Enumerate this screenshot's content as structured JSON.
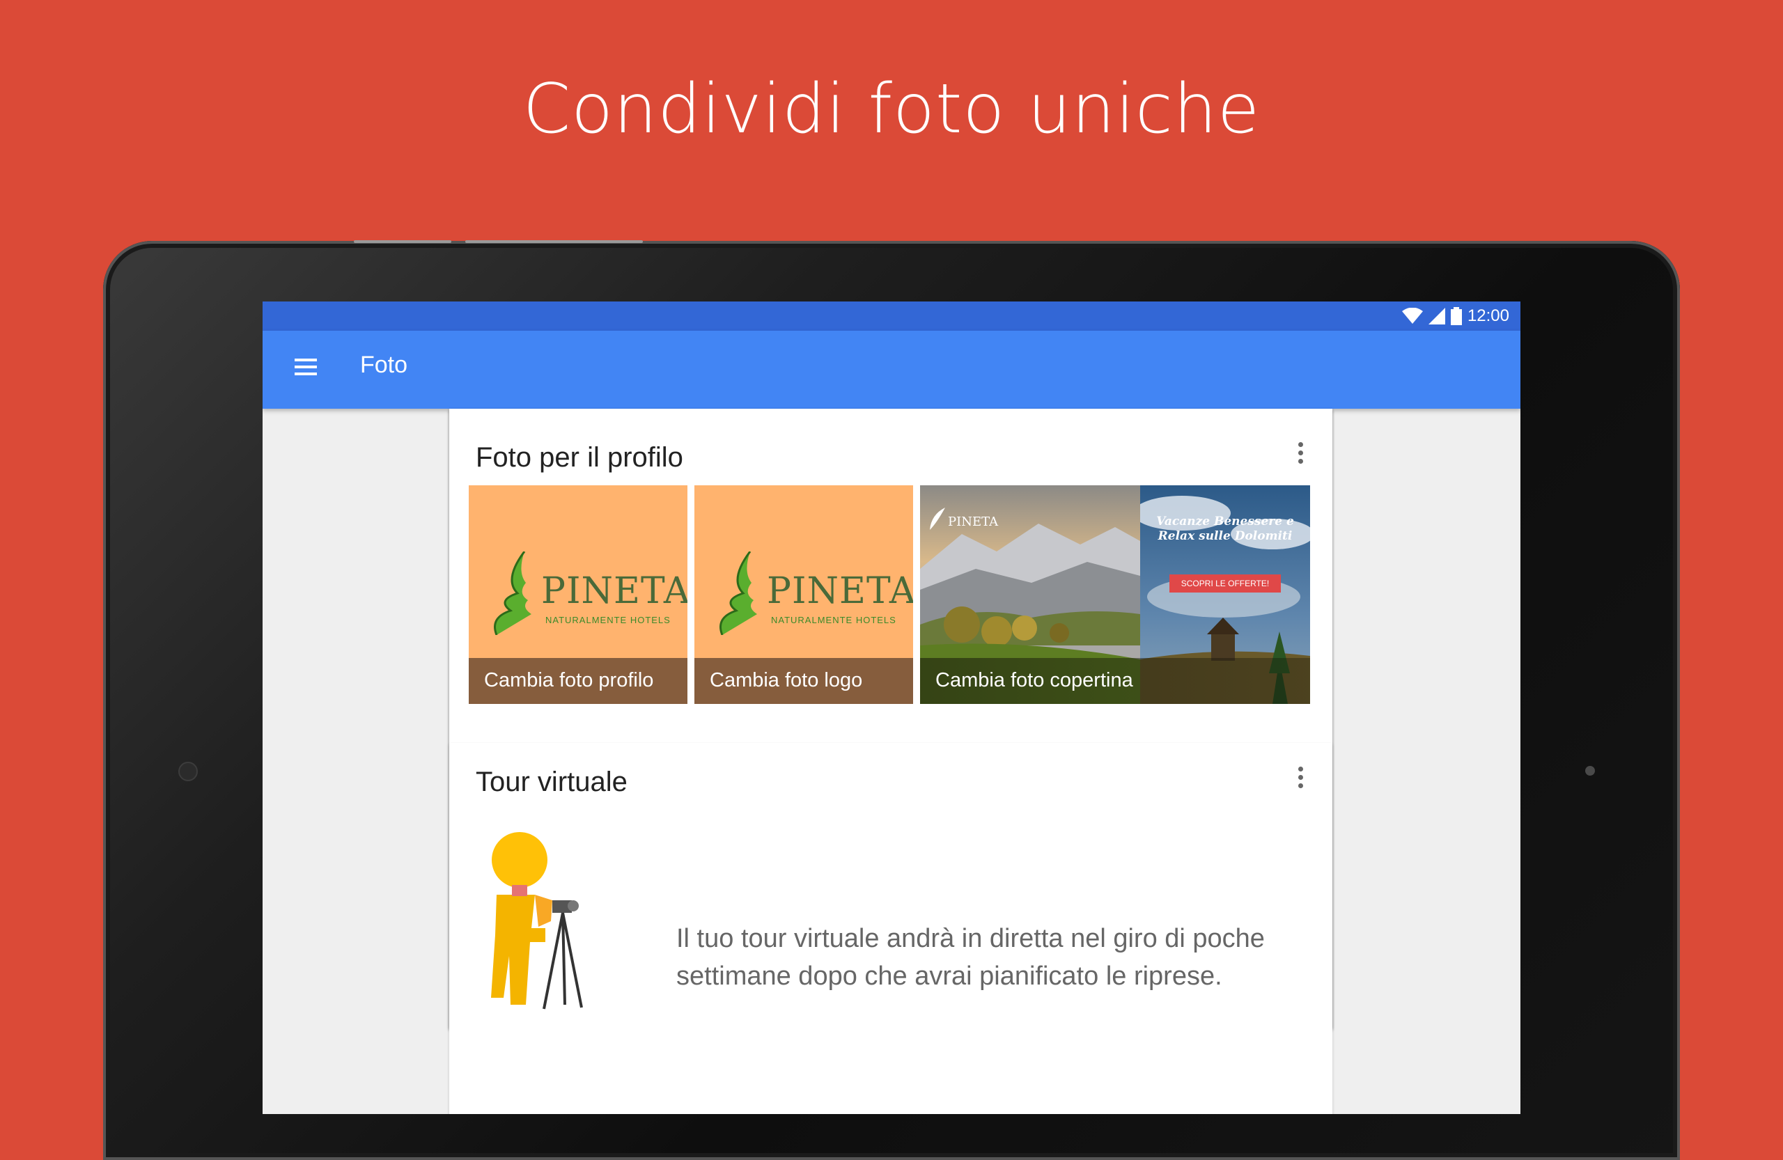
{
  "headline": "Condividi foto uniche",
  "status_bar": {
    "time": "12:00"
  },
  "app_bar": {
    "title": "Foto"
  },
  "profile_card": {
    "title": "Foto per il profilo",
    "tiles": [
      {
        "caption": "Cambia foto profilo",
        "brand": "PINETA",
        "tagline": "NATURALMENTE HOTELS"
      },
      {
        "caption": "Cambia foto logo",
        "brand": "PINETA",
        "tagline": "NATURALMENTE HOTELS"
      },
      {
        "caption": "Cambia foto copertina",
        "brand": "PINETA",
        "promo_text": "Vacanze Benessere e Relax sulle Dolomiti",
        "promo_button": "SCOPRI LE OFFERTE!"
      }
    ]
  },
  "tour_card": {
    "title": "Tour virtuale",
    "description": "Il tuo tour virtuale andrà in diretta nel giro di poche settimane dopo che avrai pianificato le riprese."
  },
  "colors": {
    "background": "#DB4A37",
    "status_bar": "#3367D6",
    "app_bar": "#4285F4",
    "logo_tile": "#FFB36E"
  }
}
